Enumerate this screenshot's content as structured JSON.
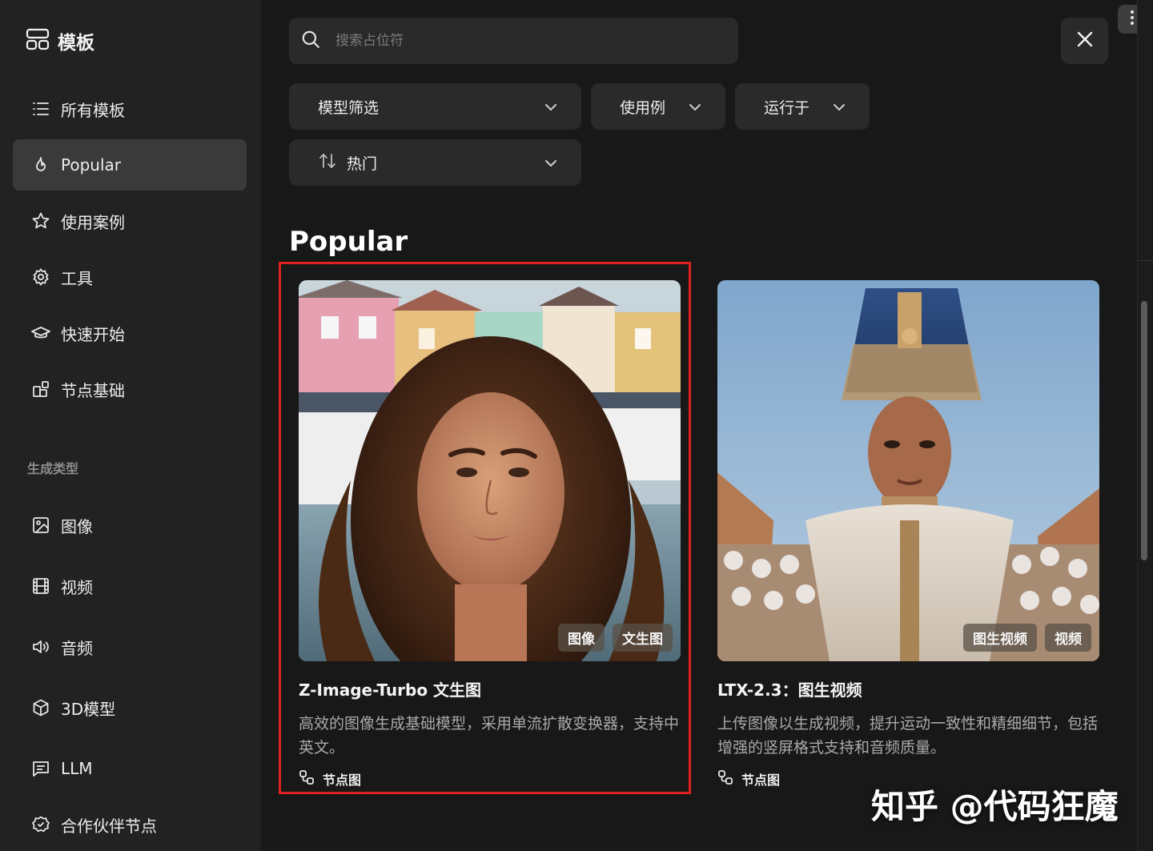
{
  "sidebar": {
    "title": "模板",
    "items": [
      {
        "label": "所有模板",
        "icon": "list-icon",
        "active": false
      },
      {
        "label": "Popular",
        "icon": "flame-icon",
        "active": true
      },
      {
        "label": "使用案例",
        "icon": "star-icon",
        "active": false
      },
      {
        "label": "工具",
        "icon": "gear-icon",
        "active": false
      },
      {
        "label": "快速开始",
        "icon": "graduation-cap-icon",
        "active": false
      },
      {
        "label": "节点基础",
        "icon": "blocks-icon",
        "active": false
      }
    ],
    "section_label": "生成类型",
    "gen_items": [
      {
        "label": "图像",
        "icon": "image-icon"
      },
      {
        "label": "视频",
        "icon": "film-icon"
      },
      {
        "label": "音频",
        "icon": "speaker-icon"
      },
      {
        "label": "3D模型",
        "icon": "cube-icon"
      },
      {
        "label": "LLM",
        "icon": "message-icon"
      },
      {
        "label": "合作伙伴节点",
        "icon": "badge-icon"
      }
    ]
  },
  "search": {
    "placeholder": "搜索占位符",
    "value": ""
  },
  "filters": {
    "model": "模型筛选",
    "use_case": "使用例",
    "runs_on": "运行于",
    "sort": "热门"
  },
  "section_heading": "Popular",
  "cards": [
    {
      "title": "Z-Image-Turbo 文生图",
      "description": "高效的图像生成基础模型，采用单流扩散变换器，支持中英文。",
      "tags": [
        "图像",
        "文生图"
      ],
      "meta": "节点图"
    },
    {
      "title": "LTX-2.3：图生视频",
      "description": "上传图像以生成视频，提升运动一致性和精细细节，包括增强的竖屏格式支持和音频质量。",
      "tags": [
        "图生视频",
        "视频"
      ],
      "meta": "节点图"
    }
  ],
  "watermark": "知乎 @代码狂魔",
  "colors": {
    "accent_highlight": "#e02020",
    "sidebar_bg": "#222222",
    "main_bg": "#181818"
  }
}
